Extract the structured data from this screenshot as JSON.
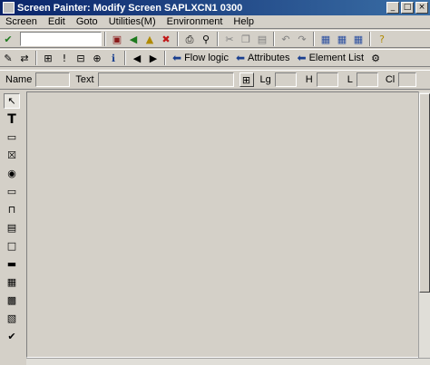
{
  "window": {
    "title": "Screen Painter: Modify Screen SAPLXCN1 0300"
  },
  "menu": [
    {
      "label": "Screen",
      "u": "S"
    },
    {
      "label": "Edit",
      "u": "E"
    },
    {
      "label": "Goto",
      "u": "G"
    },
    {
      "label": "Utilities(M)",
      "u": "U"
    },
    {
      "label": "Environment",
      "u": "n"
    },
    {
      "label": "Help",
      "u": "H"
    }
  ],
  "toolbar2": {
    "flow_logic": "Flow logic",
    "attributes": "Attributes",
    "element_list": "Element List"
  },
  "attrbar": {
    "name_label": "Name",
    "text_label": "Text",
    "lg_label": "Lg",
    "h_label": "H",
    "l_label": "L",
    "cl_label": "Cl"
  },
  "colors": {
    "title_start": "#0a246a",
    "title_end": "#3a6ea5",
    "window_bg": "#d4d0c8"
  }
}
